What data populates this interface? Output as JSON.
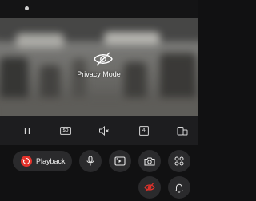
{
  "status_bar": {
    "time": ""
  },
  "camera": {
    "privacy_label": "Privacy Mode"
  },
  "controls": {
    "quality_label": "SD",
    "split_label": "4"
  },
  "actions": {
    "playback_label": "Playback"
  },
  "colors": {
    "accent_red": "#e4322b",
    "background": "#111112",
    "control_bar": "#1d1d1f",
    "button_bg": "#2a2a2c"
  }
}
